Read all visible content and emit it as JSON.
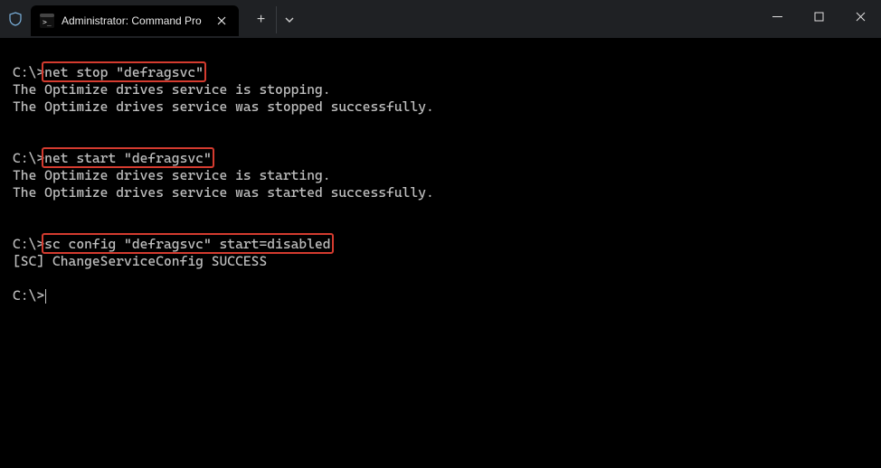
{
  "titlebar": {
    "tab_title": "Administrator: Command Pro",
    "new_tab_label": "+",
    "shield_name": "shield-icon",
    "cmd_icon_name": "cmd-prompt-icon"
  },
  "terminal": {
    "prompt": "C:\\>",
    "lines": [
      "",
      "C:\\>net stop \"defragsvc\"",
      "The Optimize drives service is stopping.",
      "The Optimize drives service was stopped successfully.",
      "",
      "",
      "C:\\>net start \"defragsvc\"",
      "The Optimize drives service is starting.",
      "The Optimize drives service was started successfully.",
      "",
      "",
      "C:\\>sc config \"defragsvc\" start=disabled",
      "[SC] ChangeServiceConfig SUCCESS",
      "",
      "C:\\>"
    ],
    "commands": [
      {
        "text": "net stop \"defragsvc\"",
        "line_index": 1
      },
      {
        "text": "net start \"defragsvc\"",
        "line_index": 6
      },
      {
        "text": "sc config \"defragsvc\" start=disabled",
        "line_index": 11
      }
    ]
  },
  "colors": {
    "window_bg": "#1f2124",
    "terminal_bg": "#000000",
    "terminal_fg": "#bfbfbf",
    "highlight_border": "#d43b2f",
    "shield_accent": "#7ab0db"
  }
}
